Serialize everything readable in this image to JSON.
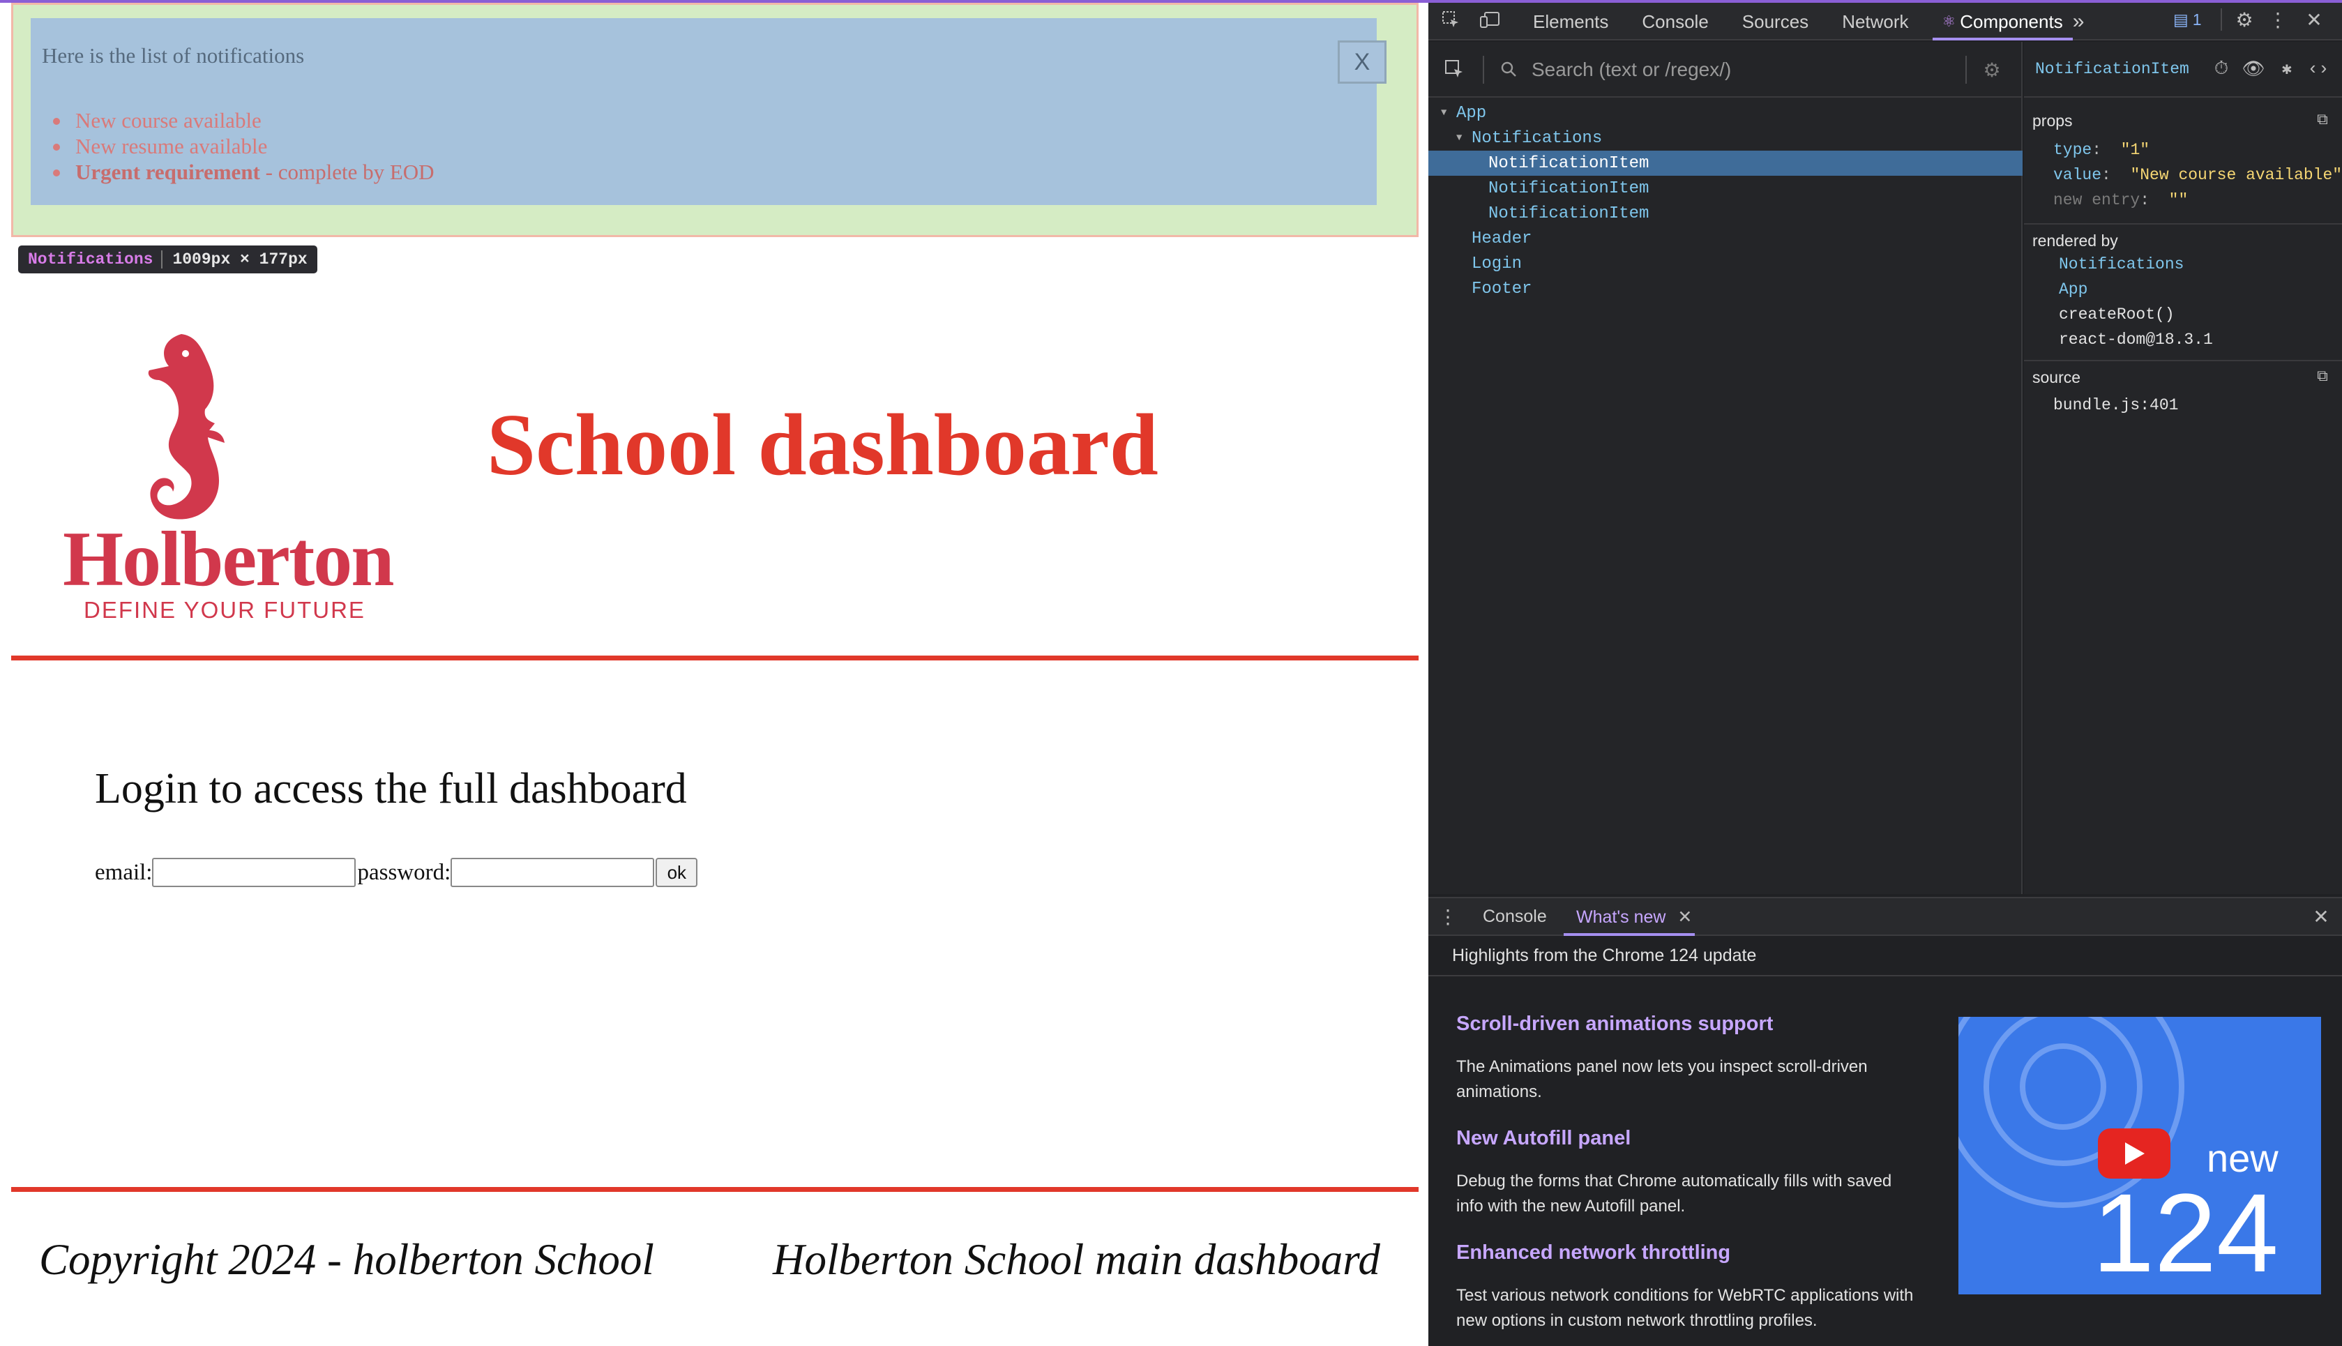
{
  "app": {
    "notifications": {
      "title": "Here is the list of notifications",
      "close_label": "X",
      "items": [
        {
          "text": "New course available",
          "type": "default"
        },
        {
          "text": "New resume available",
          "type": "default"
        },
        {
          "urgent_label": "Urgent requirement",
          "rest": " - complete by EOD",
          "type": "urgent"
        }
      ]
    },
    "inspect_tag": {
      "name": "Notifications",
      "size": "1009px × 177px"
    },
    "logo": {
      "name": "Holberton",
      "tagline": "DEFINE YOUR FUTURE"
    },
    "header_title": "School dashboard",
    "login": {
      "heading": "Login to access the full dashboard",
      "email_label": "email:",
      "password_label": "password:",
      "email_value": "",
      "password_value": "",
      "submit_label": "ok"
    },
    "footer": {
      "copyright": "Copyright 2024 - holberton School",
      "right_text": "Holberton School main dashboard"
    },
    "colors": {
      "accent": "#e1382a",
      "brand": "#d1384c",
      "notif_bg": "#a6c2dc",
      "notif_outer": "#d5ecc4"
    }
  },
  "devtools": {
    "tabs": [
      "Elements",
      "Console",
      "Sources",
      "Network",
      "Components"
    ],
    "active_tab": "Components",
    "issues_count": "1",
    "search_placeholder": "Search (text or /regex/)",
    "tree": [
      {
        "label": "App",
        "depth": 0,
        "expanded": true
      },
      {
        "label": "Notifications",
        "depth": 1,
        "expanded": true
      },
      {
        "label": "NotificationItem",
        "depth": 2,
        "selected": true
      },
      {
        "label": "NotificationItem",
        "depth": 2
      },
      {
        "label": "NotificationItem",
        "depth": 2
      },
      {
        "label": "Header",
        "depth": 1
      },
      {
        "label": "Login",
        "depth": 1
      },
      {
        "label": "Footer",
        "depth": 1
      }
    ],
    "selected_component": "NotificationItem",
    "props": {
      "section": "props",
      "entries": [
        {
          "key": "type",
          "value": "\"1\""
        },
        {
          "key": "value",
          "value": "\"New course available\""
        },
        {
          "key": "new entry",
          "value": "\"\""
        }
      ]
    },
    "rendered_by": {
      "section": "rendered by",
      "items": [
        "Notifications",
        "App",
        "createRoot()",
        "react-dom@18.3.1"
      ]
    },
    "source": {
      "section": "source",
      "file": "bundle.js:401"
    },
    "drawer": {
      "tabs": [
        "Console",
        "What's new"
      ],
      "active_tab": "What's new",
      "headline": "Highlights from the Chrome 124 update",
      "features": [
        {
          "title": "Scroll-driven animations support",
          "desc": "The Animations panel now lets you inspect scroll-driven animations."
        },
        {
          "title": "New Autofill panel",
          "desc": "Debug the forms that Chrome automatically fills with saved info with the new Autofill panel."
        },
        {
          "title": "Enhanced network throttling",
          "desc": "Test various network conditions for WebRTC applications with new options in custom network throttling profiles."
        }
      ],
      "video": {
        "word": "new",
        "number": "124"
      }
    }
  }
}
